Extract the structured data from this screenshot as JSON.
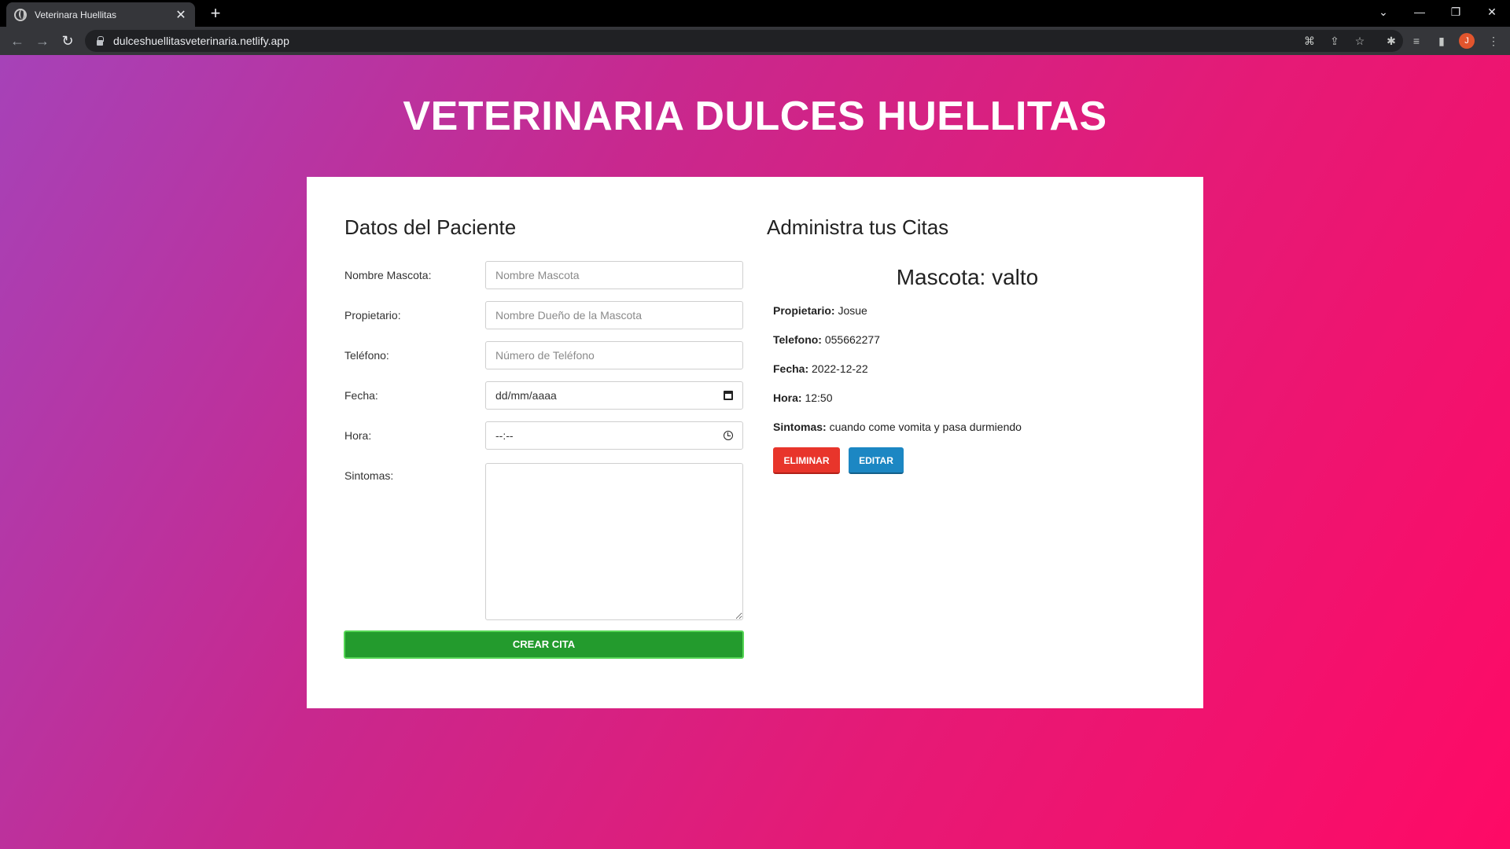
{
  "browser": {
    "tab_title": "Veterinara Huellitas",
    "tab_close": "✕",
    "new_tab": "+",
    "url": "dulceshuellitasveterinaria.netlify.app",
    "avatar_letter": "J"
  },
  "page": {
    "title": "VETERINARIA DULCES HUELLITAS"
  },
  "form": {
    "heading": "Datos del Paciente",
    "fields": [
      {
        "label": "Nombre Mascota:",
        "placeholder": "Nombre Mascota"
      },
      {
        "label": "Propietario:",
        "placeholder": "Nombre Dueño de la Mascota"
      },
      {
        "label": "Teléfono:",
        "placeholder": "Número de Teléfono"
      },
      {
        "label": "Fecha:",
        "value": "dd/mm/aaaa"
      },
      {
        "label": "Hora:",
        "value": "--:--"
      },
      {
        "label": "Sintomas:",
        "value": ""
      }
    ],
    "submit_label": "CREAR CITA"
  },
  "citas": {
    "heading": "Administra tus Citas",
    "pet_title": "Mascota: valto",
    "details": [
      {
        "key": "Propietario:",
        "value": "Josue"
      },
      {
        "key": "Telefono:",
        "value": "055662277"
      },
      {
        "key": "Fecha:",
        "value": "2022-12-22"
      },
      {
        "key": "Hora:",
        "value": "12:50"
      },
      {
        "key": "Sintomas:",
        "value": "cuando come vomita y pasa durmiendo"
      }
    ],
    "delete_label": "ELIMINAR",
    "edit_label": "EDITAR"
  }
}
